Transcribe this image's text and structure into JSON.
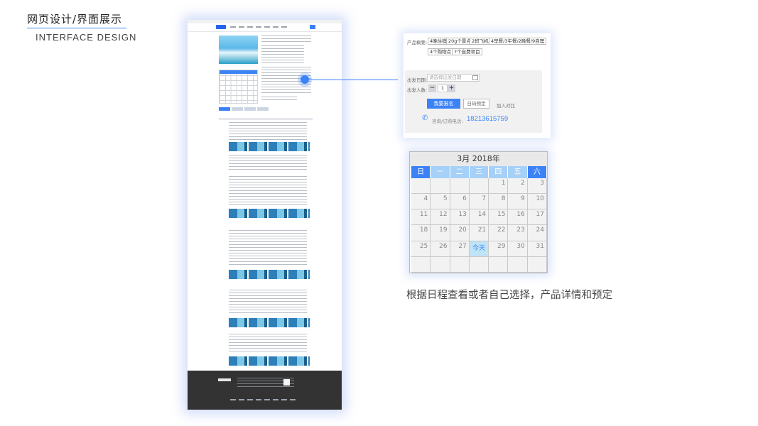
{
  "header": {
    "title": "网页设计/界面展示",
    "subtitle": "INTERFACE DESIGN"
  },
  "booking": {
    "product_info_label": "产品概要:",
    "tags": [
      "4晚住宿",
      "20g个景点",
      "2班飞机",
      "4早餐/3午餐/2晚餐/9自理",
      "4个购物点",
      "7个自费项目"
    ],
    "depart_date_label": "出发日期:",
    "date_placeholder": "请选择出发日期",
    "people_label": "出发人数:",
    "people_count": "1",
    "minus": "−",
    "plus": "+",
    "signup_button": "我要报名",
    "day_reserve": "日码预定",
    "compare": "加入对比",
    "phone_label": "咨询/订购电话:",
    "phone": "18213615759",
    "accent": "#3b82f6"
  },
  "calendar": {
    "title": "3月  2018年",
    "weekdays": [
      "日",
      "一",
      "二",
      "三",
      "四",
      "五",
      "六"
    ],
    "cells": [
      "",
      "",
      "",
      "",
      "1",
      "2",
      "3",
      "4",
      "5",
      "6",
      "7",
      "8",
      "9",
      "10",
      "11",
      "12",
      "13",
      "14",
      "15",
      "16",
      "17",
      "18",
      "19",
      "20",
      "21",
      "22",
      "23",
      "24",
      "25",
      "26",
      "27",
      "今天",
      "29",
      "30",
      "31",
      "",
      "",
      "",
      "",
      "",
      "",
      ""
    ],
    "today_label": "今天"
  },
  "caption": "根据日程查看或者自己选择，产品详情和预定"
}
